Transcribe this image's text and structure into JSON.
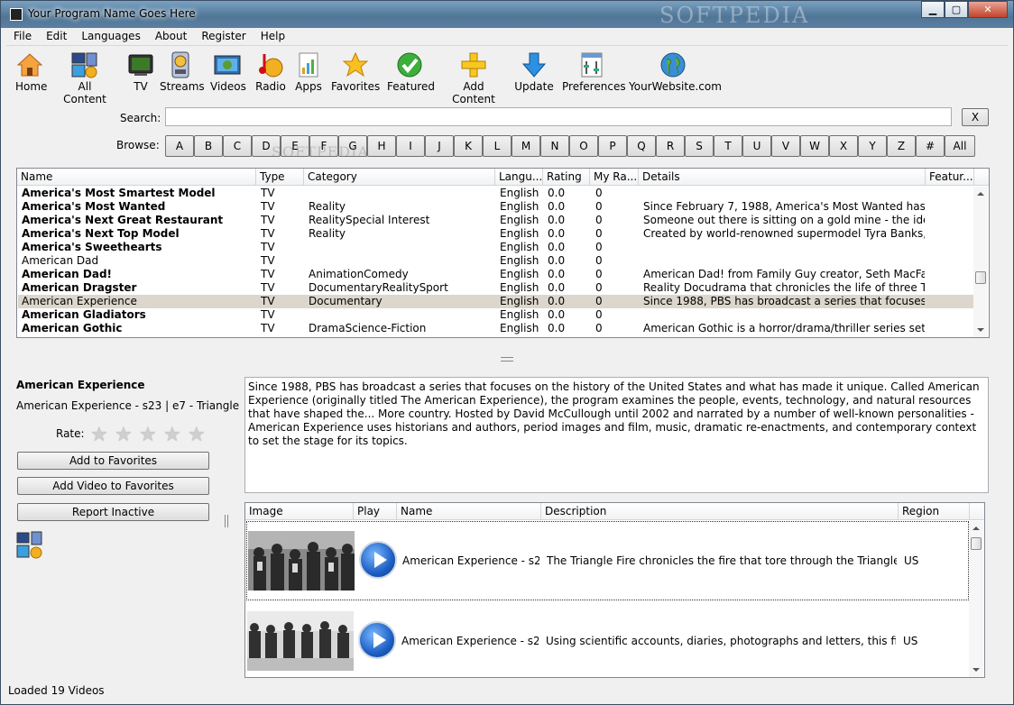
{
  "window": {
    "title": "Your Program Name Goes Here",
    "watermark": "SOFTPEDIA",
    "min": "▁",
    "max": "▢",
    "close": "✕"
  },
  "menu": [
    "File",
    "Edit",
    "Languages",
    "About",
    "Register",
    "Help"
  ],
  "toolbar": [
    {
      "label": "Home",
      "icon": "home-icon"
    },
    {
      "label": "All Content",
      "icon": "all-content-icon"
    },
    {
      "label": "TV",
      "icon": "tv-icon"
    },
    {
      "label": "Streams",
      "icon": "streams-icon"
    },
    {
      "label": "Videos",
      "icon": "videos-icon"
    },
    {
      "label": "Radio",
      "icon": "radio-icon"
    },
    {
      "label": "Apps",
      "icon": "apps-icon"
    },
    {
      "label": "Favorites",
      "icon": "star-icon"
    },
    {
      "label": "Featured",
      "icon": "check-icon"
    },
    {
      "label": "Add Content",
      "icon": "plus-icon"
    },
    {
      "label": "Update",
      "icon": "down-arrow-icon"
    },
    {
      "label": "Preferences",
      "icon": "preferences-icon"
    },
    {
      "label": "YourWebsite.com",
      "icon": "globe-icon"
    }
  ],
  "search": {
    "label": "Search:",
    "value": "",
    "clear": "X"
  },
  "browse": {
    "label": "Browse:",
    "letters": [
      "A",
      "B",
      "C",
      "D",
      "E",
      "F",
      "G",
      "H",
      "I",
      "J",
      "K",
      "L",
      "M",
      "N",
      "O",
      "P",
      "Q",
      "R",
      "S",
      "T",
      "U",
      "V",
      "W",
      "X",
      "Y",
      "Z",
      "#",
      "All"
    ]
  },
  "grid": {
    "columns": [
      "Name",
      "Type",
      "Category",
      "Langu...",
      "Rating",
      "My Ra...",
      "Details",
      "Featur..."
    ],
    "rows": [
      {
        "name": "America's Most Smartest Model",
        "type": "TV",
        "category": "",
        "lang": "English",
        "rating": "0.0",
        "my": "0",
        "details": "",
        "bold": true
      },
      {
        "name": "America's Most Wanted",
        "type": "TV",
        "category": "Reality",
        "lang": "English",
        "rating": "0.0",
        "my": "0",
        "details": "Since February 7, 1988, America's Most Wanted has captu...",
        "bold": true
      },
      {
        "name": "America's Next Great Restaurant",
        "type": "TV",
        "category": "RealitySpecial Interest",
        "lang": "English",
        "rating": "0.0",
        "my": "0",
        "details": "Someone out there is sitting on a gold mine - the idea for...",
        "bold": true
      },
      {
        "name": "America's Next Top Model",
        "type": "TV",
        "category": "Reality",
        "lang": "English",
        "rating": "0.0",
        "my": "0",
        "details": "Created by world-renowned supermodel Tyra Banks, who...",
        "bold": true
      },
      {
        "name": "America's Sweethearts",
        "type": "TV",
        "category": "",
        "lang": "English",
        "rating": "0.0",
        "my": "0",
        "details": "",
        "bold": true
      },
      {
        "name": "American Dad",
        "type": "TV",
        "category": "",
        "lang": "English",
        "rating": "0.0",
        "my": "0",
        "details": "",
        "bold": false
      },
      {
        "name": "American Dad!",
        "type": "TV",
        "category": "AnimationComedy",
        "lang": "English",
        "rating": "0.0",
        "my": "0",
        "details": "American Dad! from Family Guy creator, Seth MacFarlane...",
        "bold": true
      },
      {
        "name": "American Dragster",
        "type": "TV",
        "category": "DocumentaryRealitySport",
        "lang": "English",
        "rating": "0.0",
        "my": "0",
        "details": "Reality Docudrama that chronicles the life of three Top Fu...",
        "bold": true
      },
      {
        "name": "American Experience",
        "type": "TV",
        "category": "Documentary",
        "lang": "English",
        "rating": "0.0",
        "my": "0",
        "details": "Since 1988, PBS has broadcast a series that focuses on the...",
        "bold": false,
        "selected": true
      },
      {
        "name": "American Gladiators",
        "type": "TV",
        "category": "",
        "lang": "English",
        "rating": "0.0",
        "my": "0",
        "details": "",
        "bold": true
      },
      {
        "name": "American Gothic",
        "type": "TV",
        "category": "DramaScience-Fiction",
        "lang": "English",
        "rating": "0.0",
        "my": "0",
        "details": "American Gothic is a horror/drama/thriller series set in th...",
        "bold": true
      }
    ]
  },
  "detail": {
    "title": "American Experience",
    "subtitle": "American Experience - s23 | e7 - Triangle",
    "rate_label": "Rate:",
    "rating": 0,
    "add_favorites": "Add to Favorites",
    "add_video_favorites": "Add Video to Favorites",
    "report_inactive": "Report Inactive",
    "description": "Since 1988, PBS has broadcast a series that focuses on the history of the United States and what has made it unique. Called American Experience (originally titled The American Experience), the program examines the people, events, technology, and natural resources that have shaped the... More country. Hosted by David McCullough until 2002 and narrated by a number of well-known personalities - American Experience uses historians and authors, period images and film, music, dramatic re-enactments, and contemporary context to set the stage for its topics."
  },
  "videos": {
    "columns": [
      "Image",
      "Play",
      "Name",
      "Description",
      "Region"
    ],
    "rows": [
      {
        "name": "American Experience - s23 |...",
        "description": "The Triangle Fire chronicles the fire that tore through the Triangle Shirtw...",
        "region": "US"
      },
      {
        "name": "American Experience - s23 |...",
        "description": "Using scientific accounts, diaries, photographs and letters, this film reve...",
        "region": "US"
      }
    ]
  },
  "status": "Loaded 19 Videos"
}
